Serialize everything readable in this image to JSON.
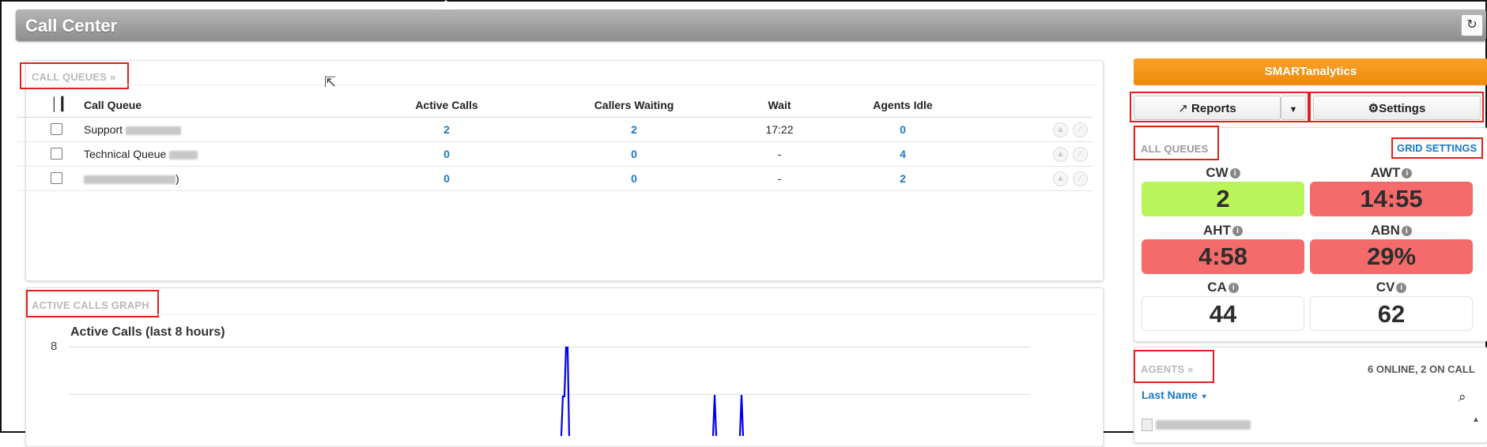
{
  "app": {
    "title": "Call Center",
    "refresh_icon": "refresh-icon"
  },
  "call_queues": {
    "title": "CALL QUEUES »",
    "columns": {
      "icon": "bar-chart-icon",
      "queue": "Call Queue",
      "active": "Active Calls",
      "waiting": "Callers Waiting",
      "wait": "Wait",
      "idle": "Agents Idle"
    },
    "rows": [
      {
        "name": "Support",
        "active": "2",
        "waiting": "2",
        "wait": "17:22",
        "idle": "0"
      },
      {
        "name": "Technical Queue",
        "active": "0",
        "waiting": "0",
        "wait": "-",
        "idle": "4"
      },
      {
        "name": ")",
        "active": "0",
        "waiting": "0",
        "wait": "-",
        "idle": "2"
      }
    ]
  },
  "graph_panel": {
    "title": "ACTIVE CALLS GRAPH",
    "chart_title": "Active Calls (last 8 hours)",
    "y_tick_top": "8"
  },
  "right": {
    "smart_label": "SMARTanalytics",
    "reports_label": "Reports",
    "settings_label": "Settings",
    "all_queues_title": "ALL QUEUES",
    "grid_settings_label": "GRID SETTINGS",
    "metrics": [
      {
        "label": "CW",
        "value": "2",
        "bg": "#b9f45b"
      },
      {
        "label": "AWT",
        "value": "14:55",
        "bg": "#f56b6b"
      },
      {
        "label": "AHT",
        "value": "4:58",
        "bg": "#f56b6b"
      },
      {
        "label": "ABN",
        "value": "29%",
        "bg": "#f56b6b"
      },
      {
        "label": "CA",
        "value": "44",
        "bg": "#ffffff"
      },
      {
        "label": "CV",
        "value": "62",
        "bg": "#ffffff"
      }
    ],
    "agents_title": "AGENTS »",
    "agents_status": "6 ONLINE, 2 ON CALL",
    "sort_label": "Last Name"
  },
  "colors": {
    "accent": "#1a79c4",
    "orange": "#f29417",
    "alert": "#f56b6b",
    "ok": "#b9f45b",
    "highlight": "#e0201b",
    "graph_line": "#0000ee"
  }
}
